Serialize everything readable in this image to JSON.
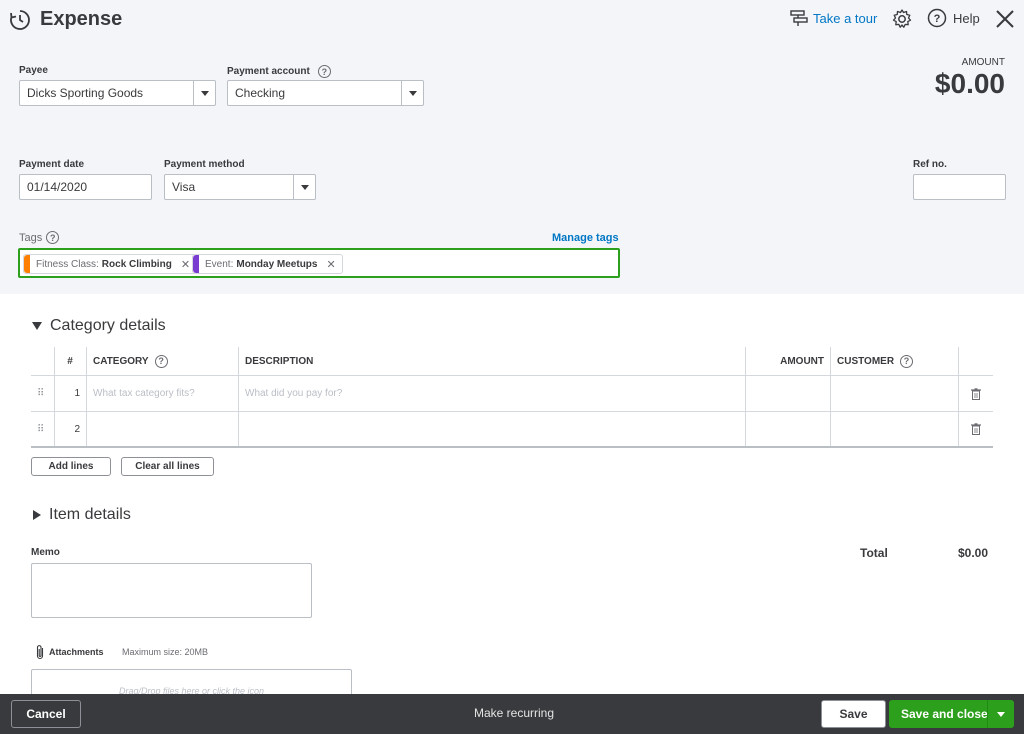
{
  "header": {
    "title": "Expense",
    "take_tour": "Take a tour",
    "help": "Help"
  },
  "form": {
    "payee_label": "Payee",
    "payee_value": "Dicks Sporting Goods",
    "account_label": "Payment account",
    "account_value": "Checking",
    "amount_label": "AMOUNT",
    "amount_value": "$0.00",
    "date_label": "Payment date",
    "date_value": "01/14/2020",
    "method_label": "Payment method",
    "method_value": "Visa",
    "ref_label": "Ref no.",
    "ref_value": ""
  },
  "tags": {
    "label": "Tags",
    "manage": "Manage tags",
    "chips": [
      {
        "group": "Fitness Class:",
        "name": "Rock Climbing",
        "color": "#ff8000"
      },
      {
        "group": "Event:",
        "name": "Monday Meetups",
        "color": "#7a3dd1"
      }
    ]
  },
  "category": {
    "title": "Category details",
    "columns": {
      "num": "#",
      "category": "CATEGORY",
      "description": "DESCRIPTION",
      "amount": "AMOUNT",
      "customer": "CUSTOMER"
    },
    "rows": [
      {
        "num": "1",
        "category_ph": "What tax category fits?",
        "description_ph": "What did you pay for?"
      },
      {
        "num": "2",
        "category_ph": "",
        "description_ph": ""
      }
    ],
    "add_lines": "Add lines",
    "clear_lines": "Clear all lines"
  },
  "items": {
    "title": "Item details"
  },
  "memo": {
    "label": "Memo",
    "total_label": "Total",
    "total_value": "$0.00"
  },
  "attachments": {
    "label": "Attachments",
    "max": "Maximum size: 20MB",
    "drop": "Drag/Drop files here or click the icon"
  },
  "footer": {
    "cancel": "Cancel",
    "recurring": "Make recurring",
    "save": "Save",
    "save_close": "Save and close"
  },
  "colors": {
    "accent": "#2ca01c",
    "link": "#0077c5"
  }
}
